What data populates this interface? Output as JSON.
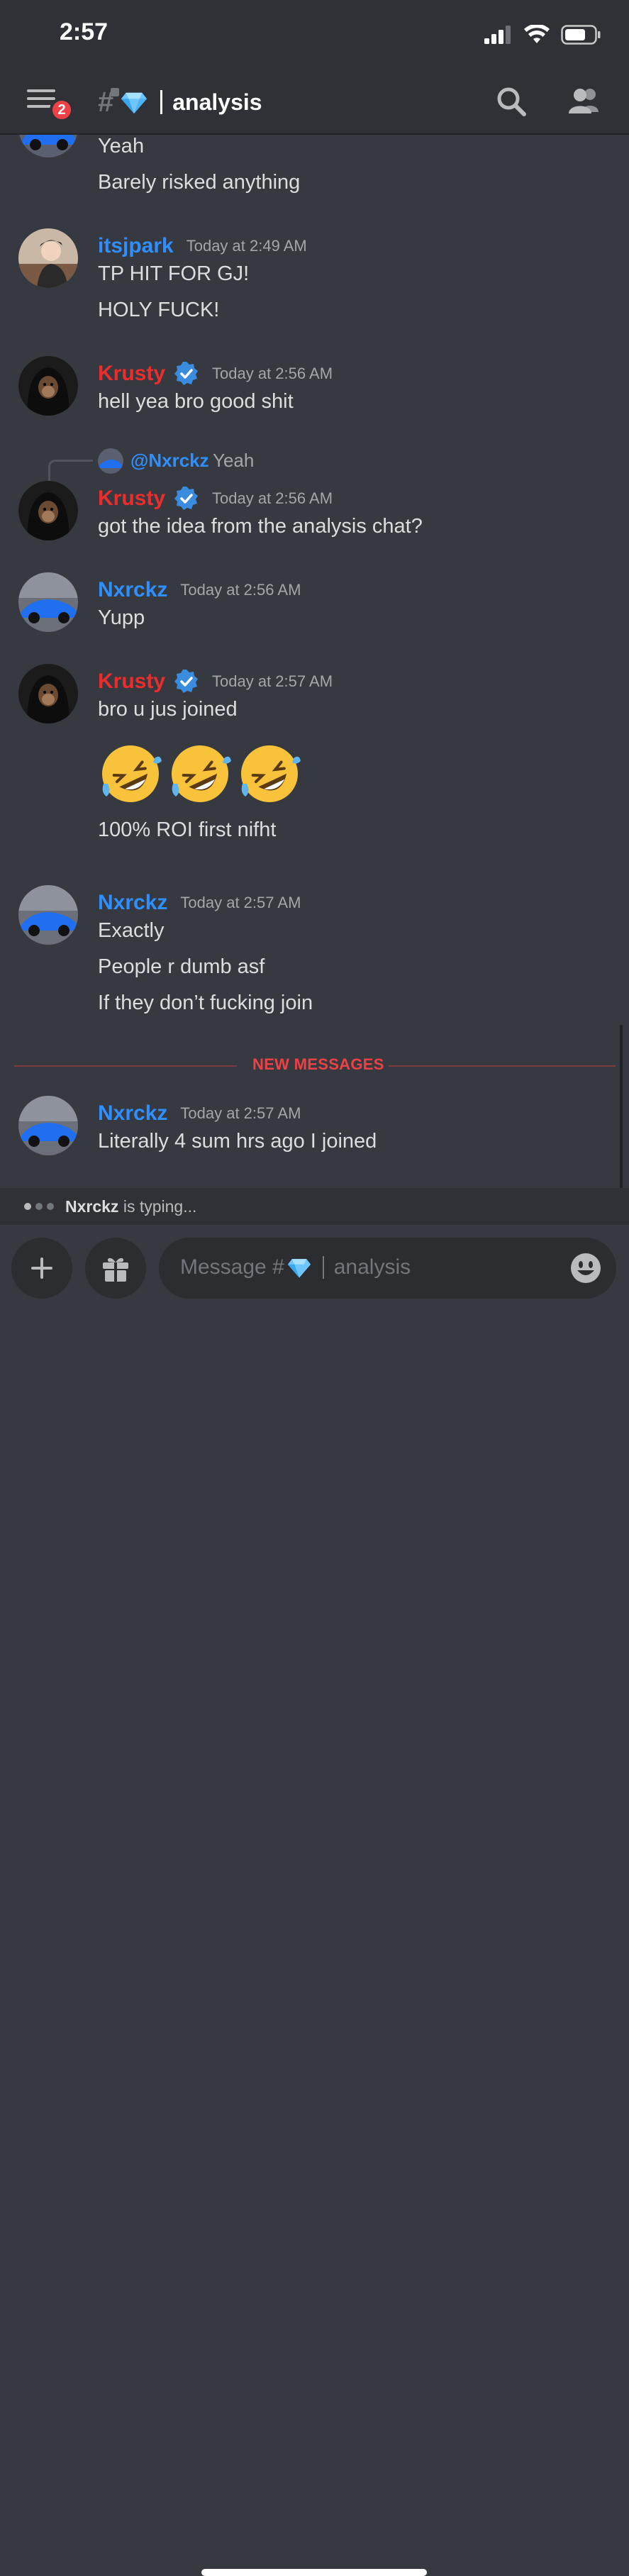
{
  "status": {
    "time": "2:57"
  },
  "header": {
    "badge_count": "2",
    "channel_name": "analysis"
  },
  "messages": {
    "top_lines": [
      "Yeah",
      "Barely risked anything"
    ],
    "itsjpark": {
      "name": "itsjpark",
      "time": "Today at 2:49 AM",
      "lines": [
        "TP HIT FOR GJ!",
        "HOLY FUCK!"
      ]
    },
    "krusty1": {
      "name": "Krusty",
      "time": "Today at 2:56 AM",
      "lines": [
        "hell yea bro good shit"
      ]
    },
    "reply": {
      "mention": "@Nxrckz",
      "text": "Yeah"
    },
    "krusty2": {
      "name": "Krusty",
      "time": "Today at 2:56 AM",
      "lines": [
        "got the idea from the analysis chat?"
      ]
    },
    "nxrckz1": {
      "name": "Nxrckz",
      "time": "Today at 2:56 AM",
      "lines": [
        "Yupp"
      ]
    },
    "krusty3": {
      "name": "Krusty",
      "time": "Today at 2:57 AM",
      "lines": [
        "bro u jus joined",
        "100% ROI first nifht"
      ],
      "emoji_name": "rolling-on-floor-laughing",
      "emoji_count": 3
    },
    "nxrckz2": {
      "name": "Nxrckz",
      "time": "Today at 2:57 AM",
      "lines": [
        "Exactly",
        "People r dumb asf",
        "If they don’t fucking join"
      ]
    },
    "divider": "NEW MESSAGES",
    "nxrckz3": {
      "name": "Nxrckz",
      "time": "Today at 2:57 AM",
      "lines": [
        "Literally 4 sum hrs ago I joined"
      ]
    }
  },
  "typing": {
    "user": "Nxrckz",
    "suffix": "is typing..."
  },
  "composer": {
    "placeholder_prefix": "Message #",
    "placeholder_channel": "analysis"
  },
  "colors": {
    "background": "#36393f",
    "header": "#2f3136",
    "name_blue": "#2f8fff",
    "name_red": "#ed2d2d",
    "new_messages": "#ed4245"
  },
  "icons": [
    "menu-icon",
    "hash-lock-icon",
    "gem-icon",
    "search-icon",
    "members-icon",
    "verified-icon",
    "plus-icon",
    "gift-icon",
    "emoji-icon"
  ]
}
